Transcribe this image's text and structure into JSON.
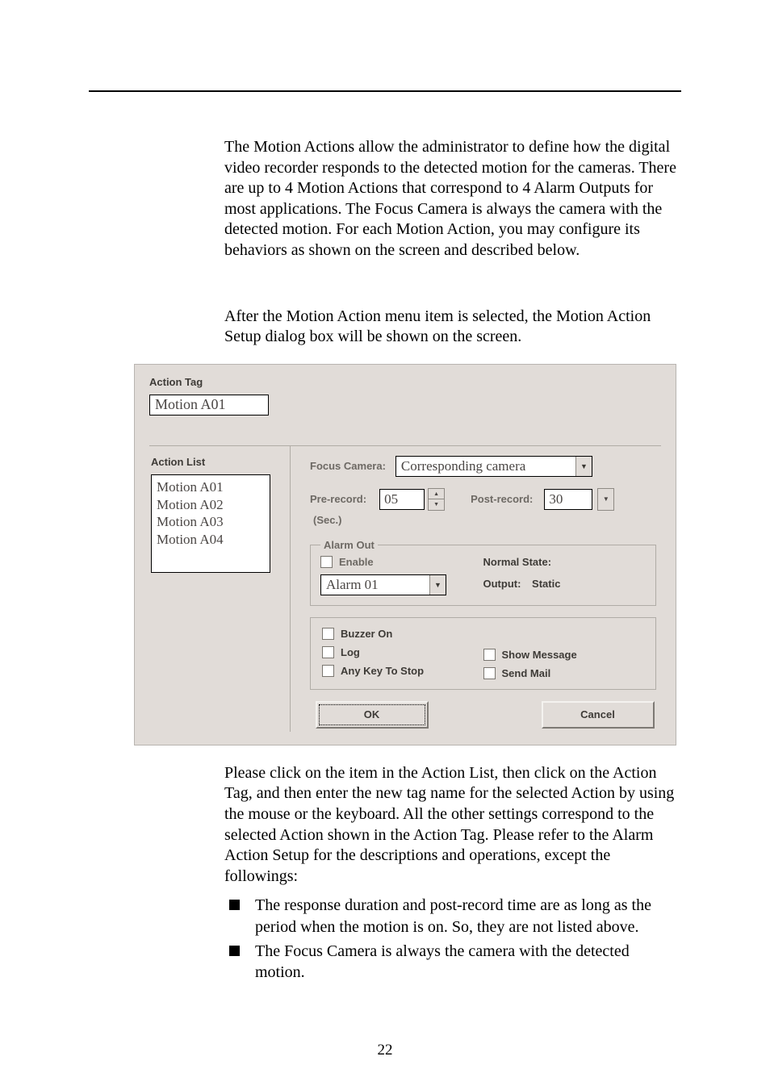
{
  "para1": "The Motion Actions allow the administrator to define how the digital video recorder responds to the detected motion for the cameras. There are up to 4 Motion Actions that correspond to 4 Alarm Outputs for most applications.   The Focus Camera is always the camera with the detected motion.   For each Motion Action, you may configure its behaviors as shown on the screen and described below.",
  "para2": "After the Motion Action menu item is selected, the Motion Action Setup dialog box will be shown on the screen.",
  "para3": "Please click on the item in the Action List, then click on the Action Tag, and then enter the new tag name for the selected Action by using the mouse or the keyboard.   All the other settings correspond to the selected Action shown in the Action Tag.   Please refer to the Alarm Action Setup for the descriptions and operations, except the followings:",
  "bullets": {
    "b1": "The response duration and post-record time are as long as the period when the motion is on.   So, they are not listed above.",
    "b2": "The Focus Camera is always the camera with the detected motion."
  },
  "pagenum": "22",
  "dlg": {
    "actionTagLabel": "Action Tag",
    "actionTagValue": "Motion A01",
    "actionListLabel": "Action List",
    "listItems": {
      "i1": "Motion A01",
      "i2": "Motion A02",
      "i3": "Motion A03",
      "i4": "Motion A04"
    },
    "focusCameraLabel": "Focus Camera:",
    "focusCameraValue": "Corresponding camera",
    "preRecordLabel": "Pre-record:",
    "preRecordValue": "05",
    "secLabel": "(Sec.)",
    "postRecordLabel": "Post-record:",
    "postRecordValue": "30",
    "alarmOutLabel": "Alarm Out",
    "enableLabel": "Enable",
    "alarmSelectValue": "Alarm 01",
    "normalStateLabel": "Normal State:",
    "outputLabel": "Output:",
    "staticLabel": "Static",
    "buzzerLabel": "Buzzer On",
    "logLabel": "Log",
    "anyKeyLabel": "Any Key To Stop",
    "showMsgLabel": "Show Message",
    "sendMailLabel": "Send Mail",
    "okLabel": "OK",
    "cancelLabel": "Cancel"
  }
}
